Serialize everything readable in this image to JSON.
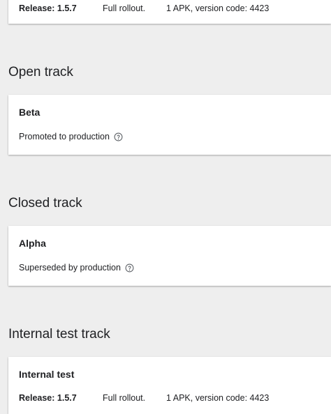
{
  "top_release": {
    "release_label": "Release: 1.5.7",
    "rollout": "Full rollout.",
    "apk_info": "1 APK, version code: 4423"
  },
  "open_track": {
    "section_title": "Open track",
    "card_title": "Beta",
    "status": "Promoted to production",
    "status_icon": "help-circle-icon"
  },
  "closed_track": {
    "section_title": "Closed track",
    "card_title": "Alpha",
    "status": "Superseded by production",
    "status_icon": "help-circle-icon"
  },
  "internal_track": {
    "section_title": "Internal test track",
    "card_title": "Internal test",
    "release_label": "Release: 1.5.7",
    "rollout": "Full rollout.",
    "apk_info": "1 APK, version code: 4423"
  },
  "colors": {
    "page_background": "#eeeeee",
    "card_background": "#ffffff",
    "text": "#202124",
    "icon": "#5f6368"
  }
}
